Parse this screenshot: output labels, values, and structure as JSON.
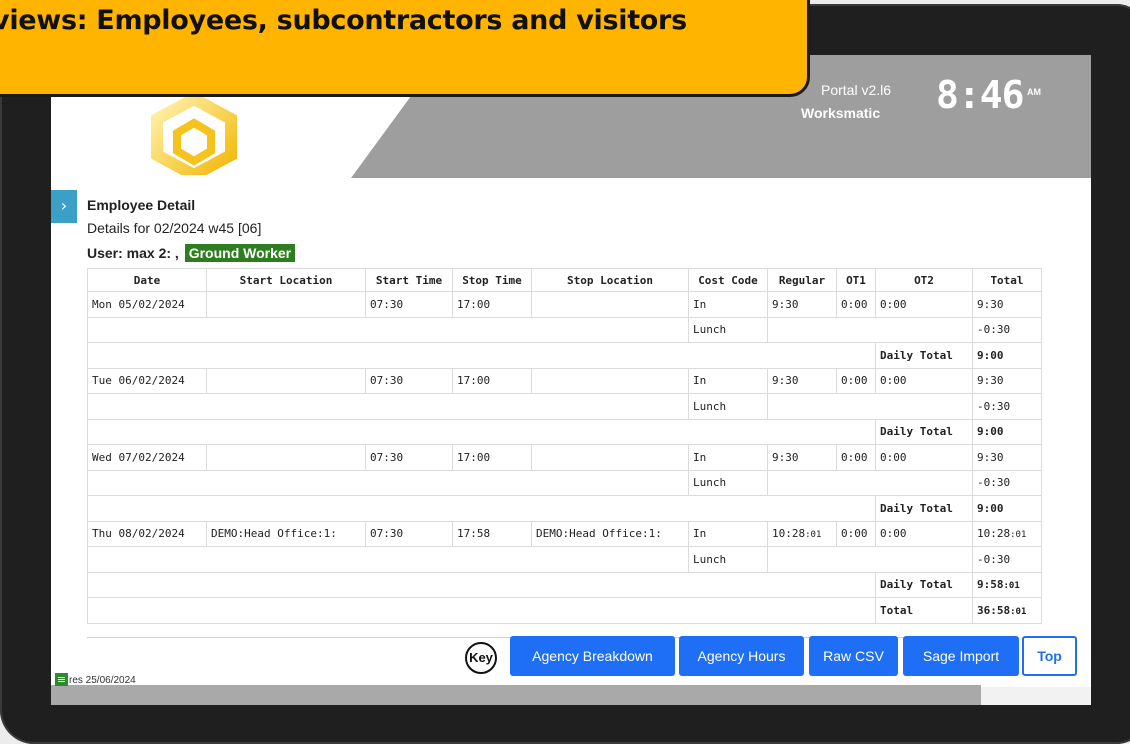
{
  "banner": {
    "title": "erviews: Employees, subcontractors and visitors"
  },
  "header": {
    "portal_version": "Portal v2.l6",
    "company": "Worksmatic",
    "clock_time": "8:46",
    "clock_ampm": "AM"
  },
  "report": {
    "title": "Employee Detail",
    "subtitle": "Details for 02/2024 w45 [06]",
    "user_label": "User: max 2: ,",
    "role": "Ground Worker",
    "columns": [
      "Date",
      "Start Location",
      "Start Time",
      "Stop Time",
      "Stop Location",
      "Cost Code",
      "Regular",
      "OT1",
      "OT2",
      "Total"
    ],
    "rows": [
      {
        "date": "Mon 05/02/2024",
        "start_location": "",
        "start_time": "07:30",
        "stop_time": "17:00",
        "stop_location": "",
        "cost_code": "In",
        "regular": "9:30",
        "ot1": "0:00",
        "ot2": "0:00",
        "total": "9:30"
      },
      {
        "cost_code": "Lunch",
        "total": "-0:30"
      },
      {
        "daily_label": "Daily Total",
        "daily_total": "9:00"
      },
      {
        "date": "Tue 06/02/2024",
        "start_location": "",
        "start_time": "07:30",
        "stop_time": "17:00",
        "stop_location": "",
        "cost_code": "In",
        "regular": "9:30",
        "ot1": "0:00",
        "ot2": "0:00",
        "total": "9:30"
      },
      {
        "cost_code": "Lunch",
        "total": "-0:30"
      },
      {
        "daily_label": "Daily Total",
        "daily_total": "9:00"
      },
      {
        "date": "Wed 07/02/2024",
        "start_location": "",
        "start_time": "07:30",
        "stop_time": "17:00",
        "stop_location": "",
        "cost_code": "In",
        "regular": "9:30",
        "ot1": "0:00",
        "ot2": "0:00",
        "total": "9:30"
      },
      {
        "cost_code": "Lunch",
        "total": "-0:30"
      },
      {
        "daily_label": "Daily Total",
        "daily_total": "9:00"
      },
      {
        "date": "Thu 08/02/2024",
        "start_location": "DEMO:Head Office:1:",
        "start_time": "07:30",
        "stop_time": "17:58",
        "stop_location": "DEMO:Head Office:1:",
        "cost_code": "In",
        "regular": "10:28",
        "regular_sec": ":01",
        "ot1": "0:00",
        "ot2": "0:00",
        "total": "10:28",
        "total_sec": ":01"
      },
      {
        "cost_code": "Lunch",
        "total": "-0:30"
      },
      {
        "daily_label": "Daily Total",
        "daily_total": "9:58",
        "daily_total_sec": ":01"
      },
      {
        "grand_label": "Total",
        "grand_total": "36:58",
        "grand_total_sec": ":01"
      }
    ]
  },
  "buttons": {
    "key": "Key",
    "agency_breakdown": "Agency Breakdown",
    "agency_hours": "Agency Hours",
    "raw_csv": "Raw CSV",
    "sage_import": "Sage Import",
    "top": "Top"
  },
  "footer": {
    "text": "res 25/06/2024"
  },
  "colors": {
    "accent": "#1e6ff5",
    "banner": "#ffb400",
    "badge": "#2e7d1f",
    "header_gray": "#9e9e9e"
  },
  "icons": {
    "sidebar_toggle": "chevron-right-icon",
    "menu": "hamburger-menu-icon",
    "logo": "hexagon-logo-icon"
  }
}
